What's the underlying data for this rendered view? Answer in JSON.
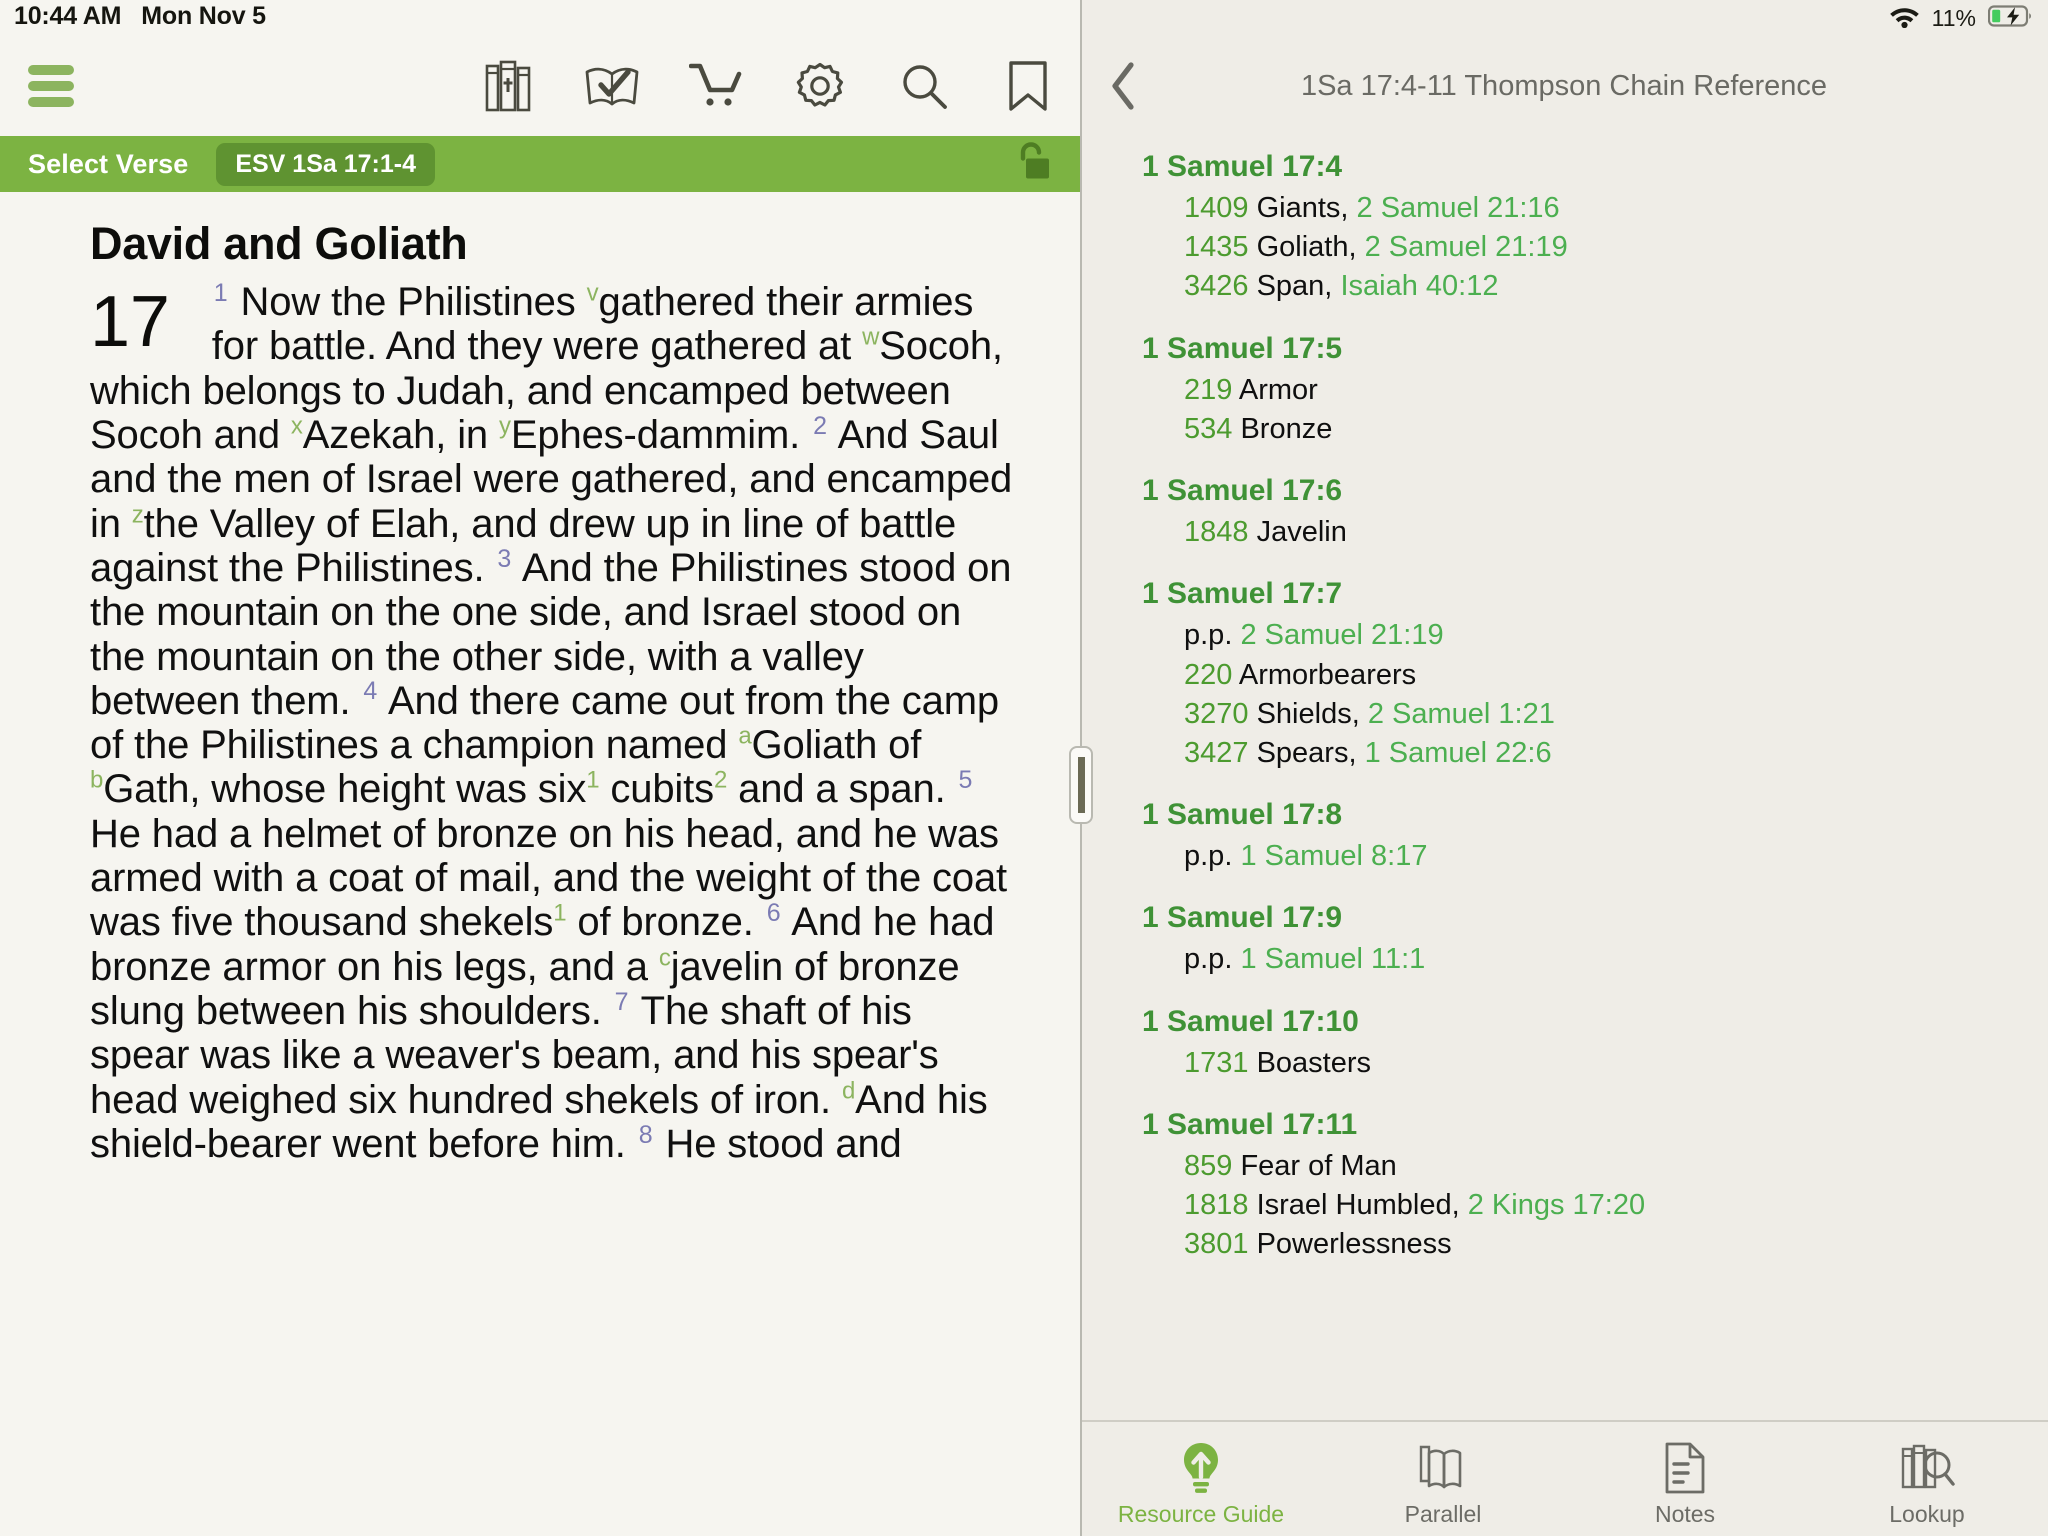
{
  "status_bar": {
    "time": "10:44 AM",
    "date": "Mon Nov 5",
    "wifi_icon": "wifi-icon",
    "battery_percent": "11%",
    "battery_icon": "battery-charging-icon"
  },
  "left_panel": {
    "menu_icon": "hamburger-menu-icon",
    "toolbar_icons": [
      {
        "name": "library-icon",
        "label": "Library"
      },
      {
        "name": "reading-plan-icon",
        "label": "Reading Plan"
      },
      {
        "name": "store-cart-icon",
        "label": "Store"
      },
      {
        "name": "settings-gear-icon",
        "label": "Settings"
      },
      {
        "name": "search-icon",
        "label": "Search"
      },
      {
        "name": "bookmark-icon",
        "label": "Bookmarks"
      }
    ],
    "verse_bar": {
      "label": "Select Verse",
      "pill_value": "ESV 1Sa 17:1-4",
      "lock_icon": "unlocked-padlock-icon"
    },
    "passage": {
      "heading": "David and Goliath",
      "chapter_number": "17",
      "verses": [
        {
          "num": "1",
          "text_parts": [
            {
              "t": "Now the Philistines "
            },
            {
              "x": "v"
            },
            {
              "t": "gathered their armies for battle. And they were gathered at "
            },
            {
              "x": "w"
            },
            {
              "t": "Socoh, which belongs to Judah, and encamped between Socoh and "
            },
            {
              "x": "x"
            },
            {
              "t": "Azekah, in "
            },
            {
              "x": "y"
            },
            {
              "t": "Ephes-dammim. "
            }
          ]
        },
        {
          "num": "2",
          "text_parts": [
            {
              "t": "And Saul and the men of Israel were gathered, and encamped in "
            },
            {
              "x": "z"
            },
            {
              "t": "the Valley of Elah, and drew up in line of battle against the Philistines. "
            }
          ]
        },
        {
          "num": "3",
          "text_parts": [
            {
              "t": "And the Philistines stood on the mountain on the one side, and Israel stood on the mountain on the other side, with a valley between them. "
            }
          ]
        },
        {
          "num": "4",
          "text_parts": [
            {
              "t": "And there came out from the camp of the Philistines a champion named "
            },
            {
              "x": "a"
            },
            {
              "t": "Goliath of "
            },
            {
              "x": "b"
            },
            {
              "t": "Gath, whose height was six"
            },
            {
              "f": "1"
            },
            {
              "t": " cubits"
            },
            {
              "f": "2"
            },
            {
              "t": " and a span. "
            }
          ]
        },
        {
          "num": "5",
          "text_parts": [
            {
              "t": "He had a helmet of bronze on his head, and he was armed with a coat of mail, and the weight of the coat was five thousand shekels"
            },
            {
              "f": "1"
            },
            {
              "t": " of bronze. "
            }
          ]
        },
        {
          "num": "6",
          "text_parts": [
            {
              "t": "And he had bronze armor on his legs, and a "
            },
            {
              "x": "c"
            },
            {
              "t": "javelin of bronze slung between his shoulders. "
            }
          ]
        },
        {
          "num": "7",
          "text_parts": [
            {
              "t": "The shaft of his spear was like a weaver's beam, and his spear's head weighed six hundred shekels of iron. "
            },
            {
              "x": "d"
            },
            {
              "t": "And his shield-bearer went before him. "
            }
          ]
        },
        {
          "num": "8",
          "text_parts": [
            {
              "t": "He stood and"
            }
          ]
        }
      ]
    }
  },
  "right_panel": {
    "back_icon": "back-chevron-icon",
    "title": "1Sa 17:4-11 Thompson Chain Reference",
    "groups": [
      {
        "title": "1 Samuel 17:4",
        "entries": [
          {
            "num": "1409",
            "topic": "Giants,",
            "link": "2 Samuel 21:16"
          },
          {
            "num": "1435",
            "topic": "Goliath,",
            "link": "2 Samuel 21:19"
          },
          {
            "num": "3426",
            "topic": "Span,",
            "link": "Isaiah 40:12"
          }
        ]
      },
      {
        "title": "1 Samuel 17:5",
        "entries": [
          {
            "num": "219",
            "topic": "Armor",
            "link": ""
          },
          {
            "num": "534",
            "topic": "Bronze",
            "link": ""
          }
        ]
      },
      {
        "title": "1 Samuel 17:6",
        "entries": [
          {
            "num": "1848",
            "topic": "Javelin",
            "link": ""
          }
        ]
      },
      {
        "title": "1 Samuel 17:7",
        "entries": [
          {
            "num": "",
            "topic": "p.p.",
            "link": "2 Samuel 21:19"
          },
          {
            "num": "220",
            "topic": "Armorbearers",
            "link": ""
          },
          {
            "num": "3270",
            "topic": "Shields,",
            "link": "2 Samuel 1:21"
          },
          {
            "num": "3427",
            "topic": "Spears,",
            "link": "1 Samuel 22:6"
          }
        ]
      },
      {
        "title": "1 Samuel 17:8",
        "entries": [
          {
            "num": "",
            "topic": "p.p.",
            "link": "1 Samuel 8:17"
          }
        ]
      },
      {
        "title": "1 Samuel 17:9",
        "entries": [
          {
            "num": "",
            "topic": "p.p.",
            "link": "1 Samuel 11:1"
          }
        ]
      },
      {
        "title": "1 Samuel 17:10",
        "entries": [
          {
            "num": "1731",
            "topic": "Boasters",
            "link": ""
          }
        ]
      },
      {
        "title": "1 Samuel 17:11",
        "entries": [
          {
            "num": "859",
            "topic": "Fear of Man",
            "link": ""
          },
          {
            "num": "1818",
            "topic": "Israel Humbled,",
            "link": "2 Kings 17:20"
          },
          {
            "num": "3801",
            "topic": "Powerlessness",
            "link": ""
          }
        ]
      }
    ],
    "tabs": [
      {
        "label": "Resource Guide",
        "icon": "lightbulb-icon",
        "active": true
      },
      {
        "label": "Parallel",
        "icon": "parallel-books-icon",
        "active": false
      },
      {
        "label": "Notes",
        "icon": "notes-document-icon",
        "active": false
      },
      {
        "label": "Lookup",
        "icon": "lookup-books-search-icon",
        "active": false
      }
    ]
  },
  "colors": {
    "accent_green": "#7cb342",
    "pill_green": "#5f9331",
    "heading_green": "#3f9236",
    "link_green": "#4caf50",
    "number_green": "#4c9b2f",
    "verse_number_purple": "#7b7bb3",
    "xref_green": "#8cb45f",
    "left_bg": "#f6f5f0",
    "right_bg": "#efede7"
  }
}
